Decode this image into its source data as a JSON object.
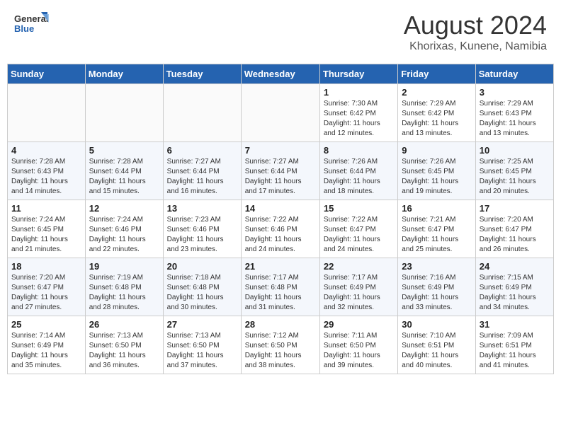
{
  "header": {
    "logo_line1": "General",
    "logo_line2": "Blue",
    "month_title": "August 2024",
    "location": "Khorixas, Kunene, Namibia"
  },
  "days_of_week": [
    "Sunday",
    "Monday",
    "Tuesday",
    "Wednesday",
    "Thursday",
    "Friday",
    "Saturday"
  ],
  "weeks": [
    [
      {
        "day": "",
        "info": ""
      },
      {
        "day": "",
        "info": ""
      },
      {
        "day": "",
        "info": ""
      },
      {
        "day": "",
        "info": ""
      },
      {
        "day": "1",
        "info": "Sunrise: 7:30 AM\nSunset: 6:42 PM\nDaylight: 11 hours\nand 12 minutes."
      },
      {
        "day": "2",
        "info": "Sunrise: 7:29 AM\nSunset: 6:42 PM\nDaylight: 11 hours\nand 13 minutes."
      },
      {
        "day": "3",
        "info": "Sunrise: 7:29 AM\nSunset: 6:43 PM\nDaylight: 11 hours\nand 13 minutes."
      }
    ],
    [
      {
        "day": "4",
        "info": "Sunrise: 7:28 AM\nSunset: 6:43 PM\nDaylight: 11 hours\nand 14 minutes."
      },
      {
        "day": "5",
        "info": "Sunrise: 7:28 AM\nSunset: 6:44 PM\nDaylight: 11 hours\nand 15 minutes."
      },
      {
        "day": "6",
        "info": "Sunrise: 7:27 AM\nSunset: 6:44 PM\nDaylight: 11 hours\nand 16 minutes."
      },
      {
        "day": "7",
        "info": "Sunrise: 7:27 AM\nSunset: 6:44 PM\nDaylight: 11 hours\nand 17 minutes."
      },
      {
        "day": "8",
        "info": "Sunrise: 7:26 AM\nSunset: 6:44 PM\nDaylight: 11 hours\nand 18 minutes."
      },
      {
        "day": "9",
        "info": "Sunrise: 7:26 AM\nSunset: 6:45 PM\nDaylight: 11 hours\nand 19 minutes."
      },
      {
        "day": "10",
        "info": "Sunrise: 7:25 AM\nSunset: 6:45 PM\nDaylight: 11 hours\nand 20 minutes."
      }
    ],
    [
      {
        "day": "11",
        "info": "Sunrise: 7:24 AM\nSunset: 6:45 PM\nDaylight: 11 hours\nand 21 minutes."
      },
      {
        "day": "12",
        "info": "Sunrise: 7:24 AM\nSunset: 6:46 PM\nDaylight: 11 hours\nand 22 minutes."
      },
      {
        "day": "13",
        "info": "Sunrise: 7:23 AM\nSunset: 6:46 PM\nDaylight: 11 hours\nand 23 minutes."
      },
      {
        "day": "14",
        "info": "Sunrise: 7:22 AM\nSunset: 6:46 PM\nDaylight: 11 hours\nand 24 minutes."
      },
      {
        "day": "15",
        "info": "Sunrise: 7:22 AM\nSunset: 6:47 PM\nDaylight: 11 hours\nand 24 minutes."
      },
      {
        "day": "16",
        "info": "Sunrise: 7:21 AM\nSunset: 6:47 PM\nDaylight: 11 hours\nand 25 minutes."
      },
      {
        "day": "17",
        "info": "Sunrise: 7:20 AM\nSunset: 6:47 PM\nDaylight: 11 hours\nand 26 minutes."
      }
    ],
    [
      {
        "day": "18",
        "info": "Sunrise: 7:20 AM\nSunset: 6:47 PM\nDaylight: 11 hours\nand 27 minutes."
      },
      {
        "day": "19",
        "info": "Sunrise: 7:19 AM\nSunset: 6:48 PM\nDaylight: 11 hours\nand 28 minutes."
      },
      {
        "day": "20",
        "info": "Sunrise: 7:18 AM\nSunset: 6:48 PM\nDaylight: 11 hours\nand 30 minutes."
      },
      {
        "day": "21",
        "info": "Sunrise: 7:17 AM\nSunset: 6:48 PM\nDaylight: 11 hours\nand 31 minutes."
      },
      {
        "day": "22",
        "info": "Sunrise: 7:17 AM\nSunset: 6:49 PM\nDaylight: 11 hours\nand 32 minutes."
      },
      {
        "day": "23",
        "info": "Sunrise: 7:16 AM\nSunset: 6:49 PM\nDaylight: 11 hours\nand 33 minutes."
      },
      {
        "day": "24",
        "info": "Sunrise: 7:15 AM\nSunset: 6:49 PM\nDaylight: 11 hours\nand 34 minutes."
      }
    ],
    [
      {
        "day": "25",
        "info": "Sunrise: 7:14 AM\nSunset: 6:49 PM\nDaylight: 11 hours\nand 35 minutes."
      },
      {
        "day": "26",
        "info": "Sunrise: 7:13 AM\nSunset: 6:50 PM\nDaylight: 11 hours\nand 36 minutes."
      },
      {
        "day": "27",
        "info": "Sunrise: 7:13 AM\nSunset: 6:50 PM\nDaylight: 11 hours\nand 37 minutes."
      },
      {
        "day": "28",
        "info": "Sunrise: 7:12 AM\nSunset: 6:50 PM\nDaylight: 11 hours\nand 38 minutes."
      },
      {
        "day": "29",
        "info": "Sunrise: 7:11 AM\nSunset: 6:50 PM\nDaylight: 11 hours\nand 39 minutes."
      },
      {
        "day": "30",
        "info": "Sunrise: 7:10 AM\nSunset: 6:51 PM\nDaylight: 11 hours\nand 40 minutes."
      },
      {
        "day": "31",
        "info": "Sunrise: 7:09 AM\nSunset: 6:51 PM\nDaylight: 11 hours\nand 41 minutes."
      }
    ]
  ]
}
